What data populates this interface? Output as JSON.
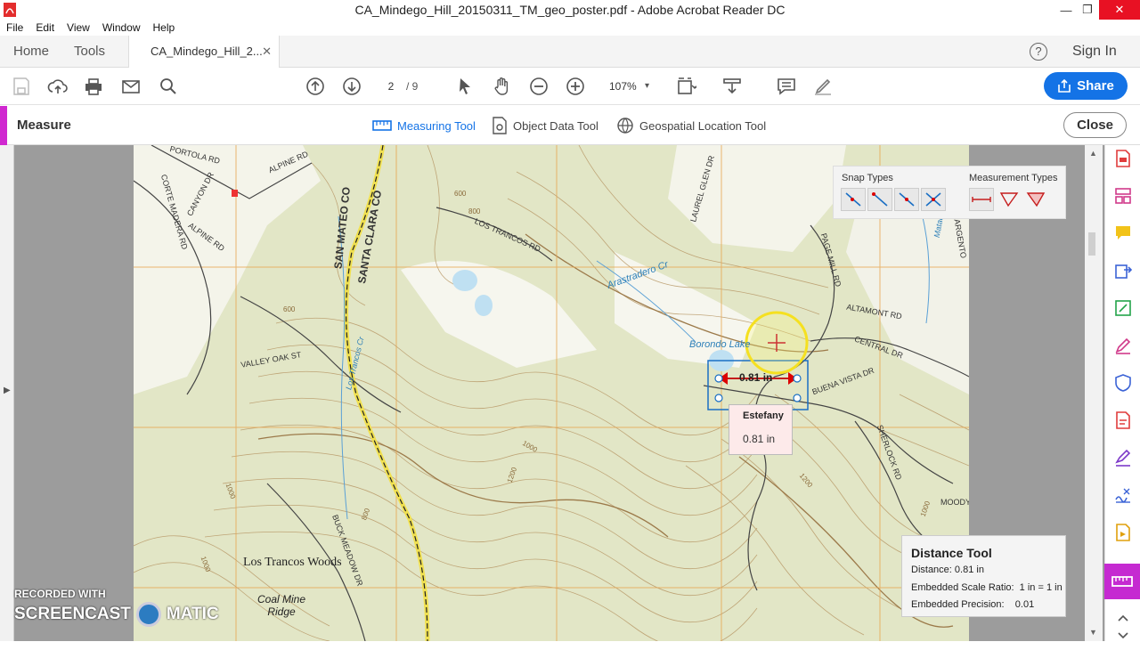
{
  "window": {
    "title": "CA_Mindego_Hill_20150311_TM_geo_poster.pdf - Adobe Acrobat Reader DC",
    "minimize": "—",
    "maximize": "❐",
    "close": "✕"
  },
  "menu": [
    "File",
    "Edit",
    "View",
    "Window",
    "Help"
  ],
  "tabs": {
    "home": "Home",
    "tools": "Tools",
    "doc": "CA_Mindego_Hill_2...",
    "doc_close": "✕",
    "help": "?",
    "sign_in": "Sign In"
  },
  "toolbar": {
    "page_current": "2",
    "page_total": "/ 9",
    "zoom": "107%",
    "zoom_caret": "▾",
    "share": "Share"
  },
  "measure": {
    "title": "Measure",
    "tools": [
      "Measuring Tool",
      "Object Data Tool",
      "Geospatial Location Tool"
    ],
    "close": "Close"
  },
  "snap_panel": {
    "snap_label": "Snap Types",
    "measurement_label": "Measurement Types"
  },
  "map": {
    "labels": [
      "PORTOLA RD",
      "ALPINE RD",
      "CORTE MADERA RD",
      "CANYON DR",
      "ALPINE RD",
      "SAN MATEO CO",
      "SANTA CLARA CO",
      "LOS TRANCOS RD",
      "Arastradero Cr",
      "LAUREL GLEN DR",
      "PAGE MILL RD",
      "ALTAMONT RD",
      "CENTRAL DR",
      "Borondo Lake",
      "BUENA VISTA DR",
      "VALLEY OAK ST",
      "Los Trancos Cr",
      "BUCK MEADOW DR",
      "Los Trancos Woods",
      "Coal Mine Ridge",
      "SHERLOCK RD",
      "MOODY",
      "Matadero",
      "ARGENTO"
    ],
    "contours": [
      "600",
      "800",
      "600",
      "1000",
      "1000",
      "1000",
      "1200",
      "1200",
      "1000",
      "800"
    ],
    "measurement_label": "0.81 in"
  },
  "tooltip": {
    "author": "Estefany",
    "value": "0.81 in"
  },
  "distance_tool": {
    "title": "Distance Tool",
    "distance": "Distance: 0.81 in",
    "scale": "Embedded Scale Ratio:  1 in = 1 in",
    "precision": "Embedded Precision:    0.01"
  },
  "watermark": {
    "line1": "RECORDED WITH",
    "line2a": "SCREENCAST",
    "line2b": "MATIC"
  },
  "colors": {
    "accent_blue": "#1473e6",
    "measure_magenta": "#d028d0",
    "map_bg": "#e2e6c6",
    "contour": "#b89968",
    "grid": "#e8a550"
  }
}
